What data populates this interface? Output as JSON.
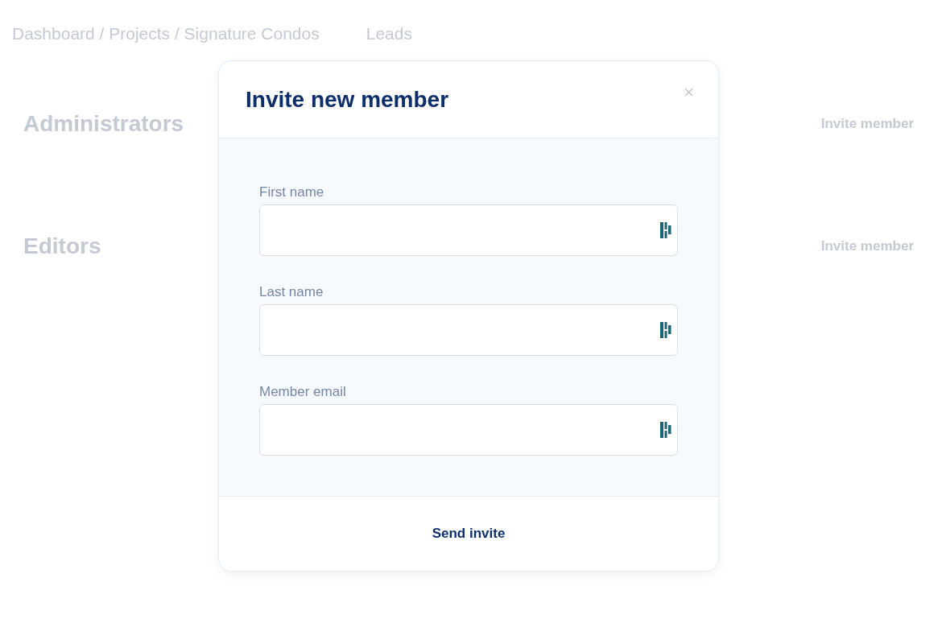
{
  "breadcrumb": {
    "path": "Dashboard / Projects / Signature Condos",
    "link": "Leads"
  },
  "sections": [
    {
      "title": "Administrators",
      "action": "Invite member"
    },
    {
      "title": "Editors",
      "action": "Invite member"
    }
  ],
  "dialog": {
    "title": "Invite new member",
    "fields": [
      {
        "label": "First name"
      },
      {
        "label": "Last name"
      },
      {
        "label": "Member email"
      }
    ],
    "submit": "Send invite"
  }
}
